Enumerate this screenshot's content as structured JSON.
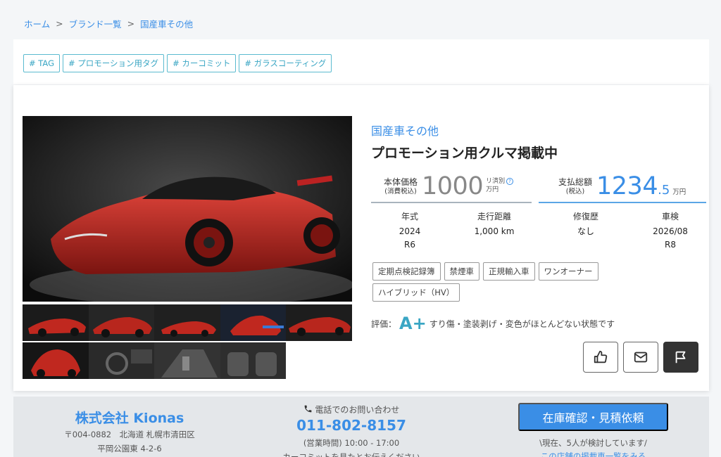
{
  "breadcrumb": [
    {
      "label": "ホーム"
    },
    {
      "label": "ブランド一覧"
    },
    {
      "label": "国産車その他"
    }
  ],
  "breadcrumb_separator": ">",
  "tags": [
    "# TAG",
    "# プロモーション用タグ",
    "# カーコミット",
    "# ガラスコーティング"
  ],
  "vehicle": {
    "brand": "国産車その他",
    "title": "プロモーション用クルマ掲載中"
  },
  "price": {
    "body_label": "本体価格",
    "body_sub": "(消費税込)",
    "body_value": "1000",
    "body_unit_top": "リ済別",
    "body_unit": "万円",
    "total_label": "支払総額",
    "total_sub": "(税込)",
    "total_value": "1234",
    "total_decimal": ".5",
    "total_unit": "万円"
  },
  "specs": [
    {
      "key": "年式",
      "lines": [
        "2024",
        "R6"
      ]
    },
    {
      "key": "走行距離",
      "lines": [
        "1,000 km"
      ]
    },
    {
      "key": "修復歴",
      "lines": [
        "なし"
      ]
    },
    {
      "key": "車検",
      "lines": [
        "2026/08",
        "R8"
      ]
    }
  ],
  "features": [
    "定期点検記録簿",
    "禁煙車",
    "正規輸入車",
    "ワンオーナー",
    "ハイブリッド（HV）"
  ],
  "rating": {
    "label": "評価：",
    "grade": "A+",
    "description": "すり傷・塗装剥げ・変色がほとんどない状態です"
  },
  "actions": [
    {
      "icon": "thumbs-up-icon"
    },
    {
      "icon": "mail-icon"
    },
    {
      "icon": "flag-icon"
    }
  ],
  "dealer": {
    "name": "株式会社 Kionas",
    "address1": "〒004-0882　北海道 札幌市清田区",
    "address2": "平岡公園東 4-2-6",
    "phone_label": "電話でのお問い合わせ",
    "phone": "011-802-8157",
    "hours": "(営業時間) 10:00 - 17:00",
    "phone_note": "カーコミットを見たとお伝えください"
  },
  "cta": {
    "label": "在庫確認・見積依頼",
    "note": "\\現在、5人が検討しています/",
    "link": "この店舗の掲載車一覧をみる"
  },
  "colors": {
    "accent": "#3a8ee6",
    "tag": "#3aa6c4",
    "car_red": "#c0281f"
  }
}
